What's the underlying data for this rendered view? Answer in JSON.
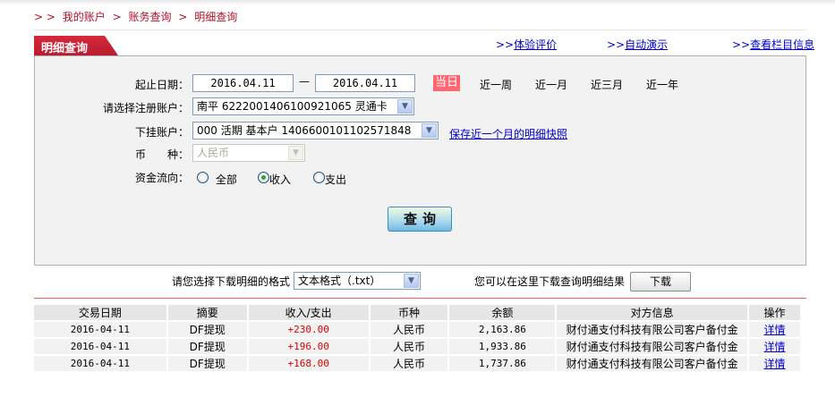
{
  "breadcrumb": {
    "prefix": "> >",
    "items": [
      "我的账户",
      "账务查询",
      "明细查询"
    ],
    "sep": ">"
  },
  "tab": {
    "label": "明细查询"
  },
  "top_links": [
    {
      "prefix": ">>",
      "label": "体验评价"
    },
    {
      "prefix": ">>",
      "label": "自动演示"
    },
    {
      "prefix": ">>",
      "label": "查看栏目信息"
    }
  ],
  "form": {
    "date_label": "起止日期：",
    "start_date": "2016.04.11",
    "dash": "—",
    "end_date": "2016.04.11",
    "ranges": [
      "当日",
      "近一周",
      "近一月",
      "近三月",
      "近一年"
    ],
    "account_label": "请选择注册账户：",
    "account_value": "南平 6222001406100921065 灵通卡",
    "sub_label": "下挂账户：",
    "sub_value": "000 活期 基本户 1406600101102571848",
    "save_link": "保存近一个月的明细快照",
    "currency_label": "币　　种：",
    "currency_value": "人民币",
    "flow_label": "资金流向：",
    "flow_options": [
      "全部",
      "收入",
      "支出"
    ],
    "flow_selected": "收入",
    "query_button": "查询"
  },
  "download": {
    "format_label": "请您选择下载明细的格式",
    "format_value": "文本格式（.txt）",
    "hint": "您可以在这里下载查询明细结果",
    "button": "下载"
  },
  "table": {
    "headers": [
      "交易日期",
      "摘要",
      "收入/支出",
      "币种",
      "余额",
      "对方信息",
      "操作"
    ],
    "rows": [
      [
        "2016-04-11",
        "DF提现",
        "+230.00",
        "人民币",
        "2,163.86",
        "财付通支付科技有限公司客户备付金",
        "详情"
      ],
      [
        "2016-04-11",
        "DF提现",
        "+196.00",
        "人民币",
        "1,933.86",
        "财付通支付科技有限公司客户备付金",
        "详情"
      ],
      [
        "2016-04-11",
        "DF提现",
        "+168.00",
        "人民币",
        "1,737.86",
        "财付通支付科技有限公司客户备付金",
        "详情"
      ]
    ]
  },
  "colors": {
    "brand_red": "#c0202f",
    "today_bg": "#ff6670",
    "amount": "#dd0000",
    "link": "#0000cc"
  }
}
